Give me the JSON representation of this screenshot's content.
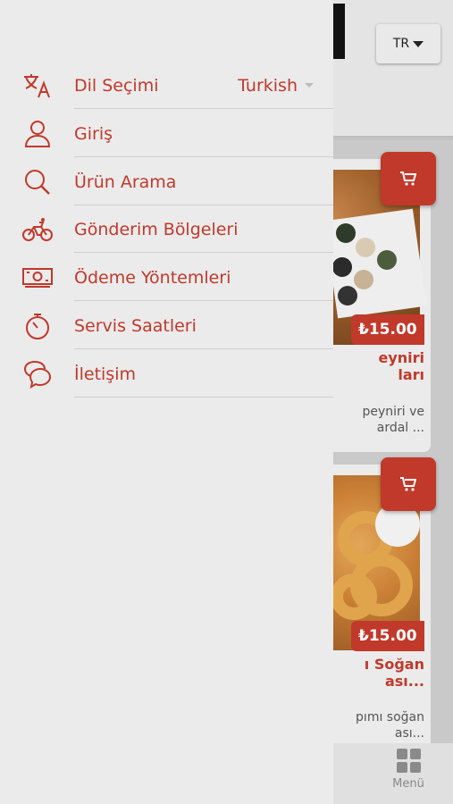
{
  "header": {
    "lang_button": "TR"
  },
  "products": [
    {
      "price": "₺15.00",
      "title_line1": "eyniri",
      "title_line2": "ları",
      "desc_line1": "peyniri ve",
      "desc_line2": "ardal ..."
    },
    {
      "price": "₺15.00",
      "title_line1": "ı Soğan",
      "title_line2": "ası...",
      "desc_line1": "pımı soğan",
      "desc_line2": "ası..."
    }
  ],
  "bottom_nav": {
    "menu_label": "Menü"
  },
  "drawer": {
    "language": {
      "label": "Dil Seçimi",
      "value": "Turkish"
    },
    "items": [
      {
        "label": "Giriş",
        "icon": "user-icon"
      },
      {
        "label": "Ürün Arama",
        "icon": "search-icon"
      },
      {
        "label": "Gönderim Bölgeleri",
        "icon": "bicycle-icon"
      },
      {
        "label": "Ödeme Yöntemleri",
        "icon": "money-icon"
      },
      {
        "label": "Servis Saatleri",
        "icon": "timer-icon"
      },
      {
        "label": "İletişim",
        "icon": "chat-icon"
      }
    ]
  },
  "colors": {
    "accent": "#c0392b",
    "drawer_bg": "#ebebeb",
    "divider": "#cfcfcf"
  }
}
